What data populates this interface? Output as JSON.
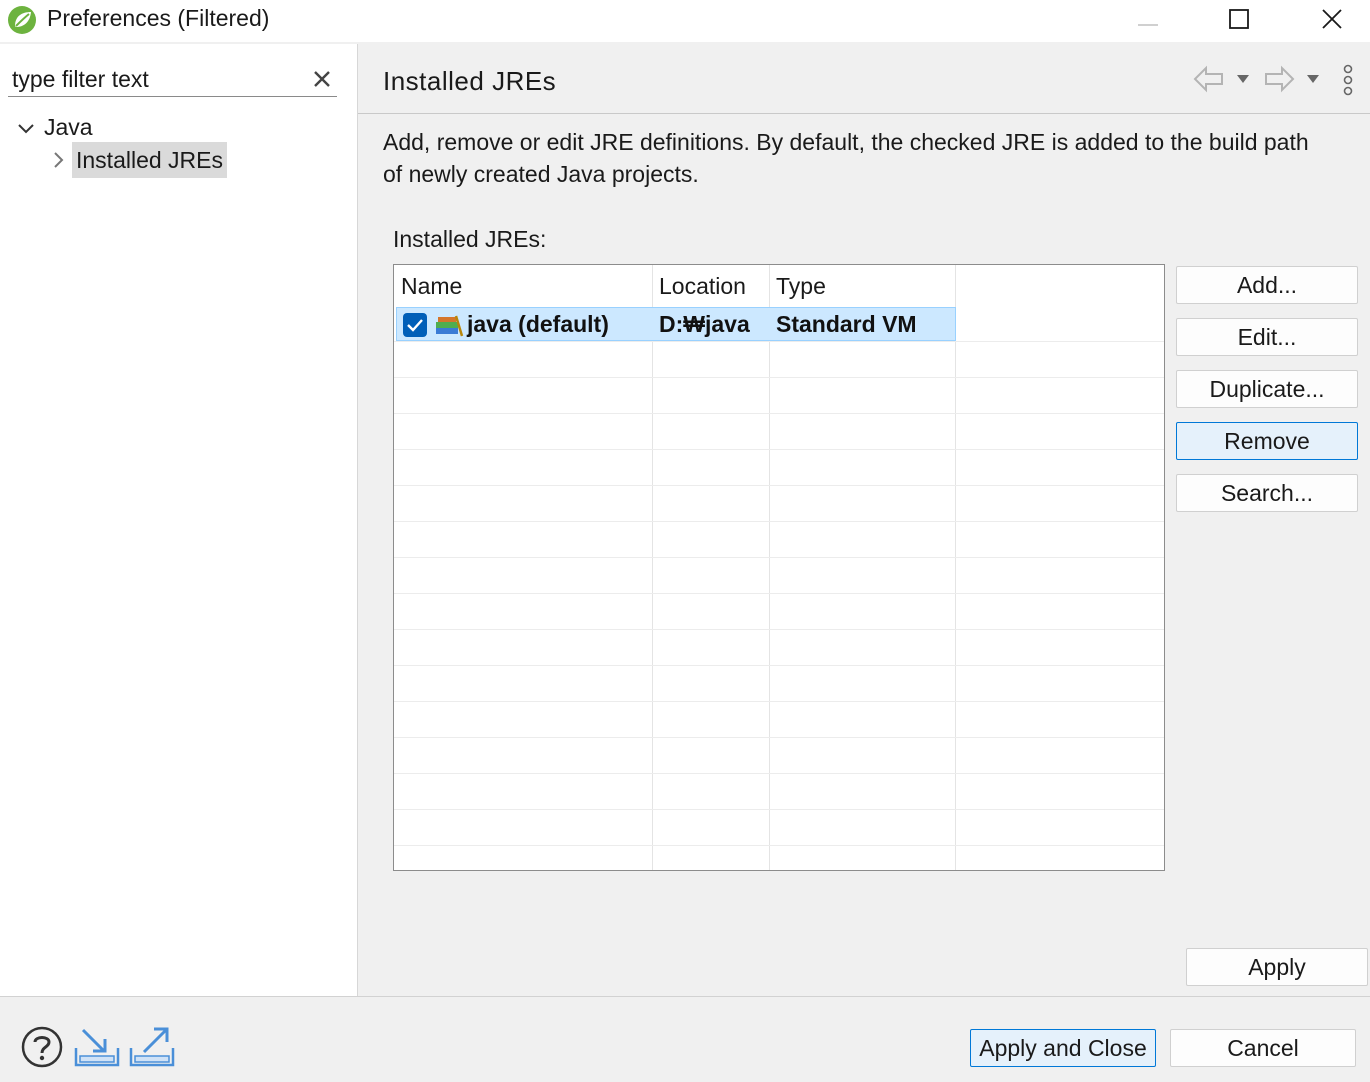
{
  "window": {
    "title": "Preferences (Filtered)",
    "minimize_icon": "minimize-icon",
    "maximize_icon": "maximize-icon",
    "close_icon": "close-icon"
  },
  "sidebar": {
    "filter_text": "type filter text",
    "tree": [
      {
        "label": "Java",
        "expanded": true,
        "icon": "chevron-down-icon"
      },
      {
        "label": "Installed JREs",
        "selected": true,
        "icon": "chevron-right-icon"
      }
    ]
  },
  "page": {
    "title": "Installed JREs",
    "description_line1": "Add, remove or edit JRE definitions. By default, the checked JRE is added to the build path",
    "description_line2": "of newly created Java projects.",
    "table_label": "Installed JREs:",
    "columns": [
      "Name",
      "Location",
      "Type"
    ],
    "rows": [
      {
        "checked": true,
        "name": "java (default)",
        "location": "D:₩java",
        "type": "Standard VM",
        "icon": "jre-library-icon"
      }
    ],
    "buttons": {
      "add": "Add...",
      "edit": "Edit...",
      "duplicate": "Duplicate...",
      "remove": "Remove",
      "search": "Search..."
    },
    "apply": "Apply"
  },
  "footer": {
    "apply_and_close": "Apply and Close",
    "cancel": "Cancel",
    "icons": [
      "help-icon",
      "import-icon",
      "export-icon"
    ]
  },
  "colors": {
    "accent": "#0078d7",
    "selection": "#cce8ff",
    "icon_blue": "#4a8fd8",
    "spring_green": "#6db33f"
  }
}
